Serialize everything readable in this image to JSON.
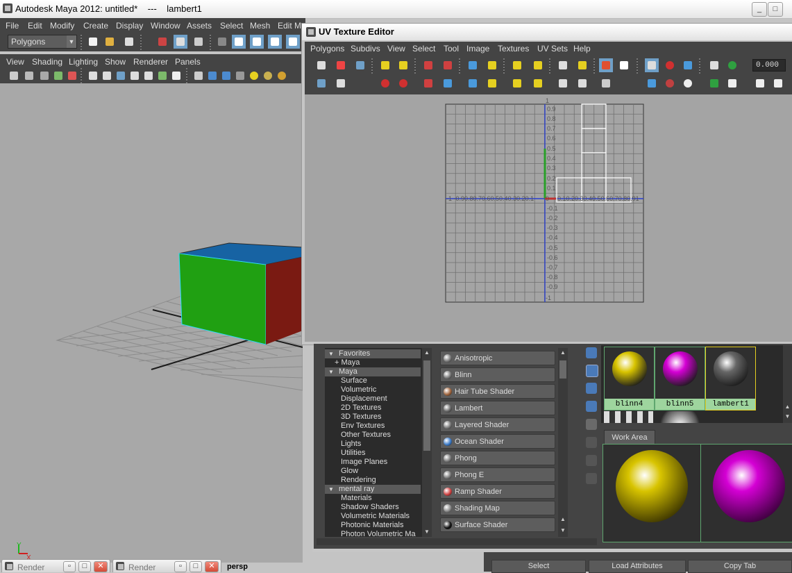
{
  "maya": {
    "title": "Autodesk Maya 2012: untitled*    ---    lambert1",
    "menus": [
      "File",
      "Edit",
      "Modify",
      "Create",
      "Display",
      "Window",
      "Assets",
      "Select",
      "Mesh",
      "Edit Me"
    ],
    "mode_selector": "Polygons",
    "panel_menus": [
      "View",
      "Shading",
      "Lighting",
      "Show",
      "Renderer",
      "Panels"
    ]
  },
  "uv_editor": {
    "title": "UV Texture Editor",
    "menus": [
      "Polygons",
      "Subdivs",
      "View",
      "Select",
      "Tool",
      "Image",
      "Textures",
      "UV Sets",
      "Help"
    ],
    "value_field": "0.000",
    "axis": {
      "y_pos": [
        "1",
        "0.9",
        "0.8",
        "0.7",
        "0.6",
        "0.5",
        "0.4",
        "0.3",
        "0.2",
        "0.1",
        "0"
      ],
      "y_neg": [
        "-0.1",
        "-0.2",
        "-0.3",
        "-0.4",
        "-0.5",
        "-0.6",
        "-0.7",
        "-0.8",
        "-0.9",
        "-1"
      ],
      "x_neg_label": "-1  -0.90.80.70.60.50.40.30.20.1",
      "x_pos_label": "0.10.20.30.40.50.60.70.80.91"
    }
  },
  "hypershade": {
    "tree": [
      {
        "label": "Favorites",
        "type": "header",
        "expander": "▼"
      },
      {
        "label": "+ Maya",
        "type": "item"
      },
      {
        "label": "Maya",
        "type": "header",
        "expander": "▼"
      },
      {
        "label": "Surface",
        "type": "item"
      },
      {
        "label": "Volumetric",
        "type": "item"
      },
      {
        "label": "Displacement",
        "type": "item"
      },
      {
        "label": "2D Textures",
        "type": "item"
      },
      {
        "label": "3D Textures",
        "type": "item"
      },
      {
        "label": "Env Textures",
        "type": "item"
      },
      {
        "label": "Other Textures",
        "type": "item"
      },
      {
        "label": "Lights",
        "type": "item"
      },
      {
        "label": "Utilities",
        "type": "item"
      },
      {
        "label": "Image Planes",
        "type": "item"
      },
      {
        "label": "Glow",
        "type": "item"
      },
      {
        "label": "Rendering",
        "type": "item"
      },
      {
        "label": "mental ray",
        "type": "header",
        "expander": "▼"
      },
      {
        "label": "Materials",
        "type": "item"
      },
      {
        "label": "Shadow Shaders",
        "type": "item"
      },
      {
        "label": "Volumetric Materials",
        "type": "item"
      },
      {
        "label": "Photonic Materials",
        "type": "item"
      },
      {
        "label": "Photon Volumetric Ma",
        "type": "item"
      }
    ],
    "materials": [
      {
        "label": "Anisotropic",
        "color": "#777777"
      },
      {
        "label": "Blinn",
        "color": "#777777"
      },
      {
        "label": "Hair Tube Shader",
        "color": "#a0643c"
      },
      {
        "label": "Lambert",
        "color": "#666666"
      },
      {
        "label": "Layered Shader",
        "color": "#777777"
      },
      {
        "label": "Ocean Shader",
        "color": "#3a7ac8"
      },
      {
        "label": "Phong",
        "color": "#777777"
      },
      {
        "label": "Phong E",
        "color": "#777777"
      },
      {
        "label": "Ramp Shader",
        "color": "#d04040"
      },
      {
        "label": "Shading Map",
        "color": "#888888"
      },
      {
        "label": "Surface Shader",
        "color": "#111111"
      }
    ],
    "swatches": [
      {
        "name": "blinn4",
        "color": "#d8c400"
      },
      {
        "name": "blinn5",
        "color": "#d400d4"
      },
      {
        "name": "lambert1",
        "color": "#666666"
      }
    ],
    "work_area_tab": "Work Area"
  },
  "bottom": {
    "render_tab_1": "Render",
    "render_tab_2": "Render",
    "camera_label": "persp",
    "buttons": [
      "Select",
      "Load Attributes",
      "Copy Tab"
    ]
  },
  "axis_gizmo": {
    "y": "Y",
    "x": "X"
  }
}
